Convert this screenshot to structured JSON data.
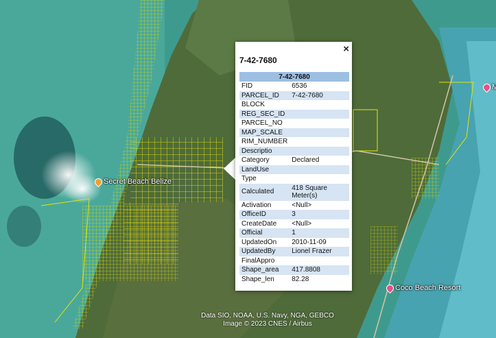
{
  "map": {
    "places": [
      {
        "label": "Secret Beach Belize",
        "color": "#f0a030",
        "icon": "place-marker-icon"
      },
      {
        "label": "Coco Beach Resort",
        "color": "#e8508a",
        "icon": "place-marker-icon"
      },
      {
        "label": "M",
        "color": "#e8508a",
        "icon": "place-marker-icon"
      }
    ],
    "attribution": [
      "Data SIO, NOAA, U.S. Navy, NGA, GEBCO",
      "Image © 2023 CNES / Airbus"
    ]
  },
  "popup": {
    "title": "7-42-7680",
    "close_icon": "×",
    "table_header": "7-42-7680",
    "rows": [
      {
        "key": "FID",
        "value": "6536"
      },
      {
        "key": "PARCEL_ID",
        "value": "7-42-7680"
      },
      {
        "key": "BLOCK",
        "value": ""
      },
      {
        "key": "REG_SEC_ID",
        "value": ""
      },
      {
        "key": "PARCEL_NO",
        "value": ""
      },
      {
        "key": "MAP_SCALE",
        "value": ""
      },
      {
        "key": "RIM_NUMBER",
        "value": ""
      },
      {
        "key": "Descriptio",
        "value": ""
      },
      {
        "key": "Category",
        "value": "Declared"
      },
      {
        "key": "LandUse",
        "value": ""
      },
      {
        "key": "Type",
        "value": ""
      },
      {
        "key": "Calculated",
        "value": "418 Square Meter(s)"
      },
      {
        "key": "Activation",
        "value": "<Null>"
      },
      {
        "key": "OfficeID",
        "value": "3"
      },
      {
        "key": "CreateDate",
        "value": "<Null>"
      },
      {
        "key": "Official",
        "value": "1"
      },
      {
        "key": "UpdatedOn",
        "value": "2010-11-09"
      },
      {
        "key": "UpdatedBy",
        "value": "Lionel Frazer"
      },
      {
        "key": "FinalAppro",
        "value": ""
      },
      {
        "key": "Shape_area",
        "value": "417.8808"
      },
      {
        "key": "Shape_len",
        "value": "82.28"
      }
    ]
  }
}
